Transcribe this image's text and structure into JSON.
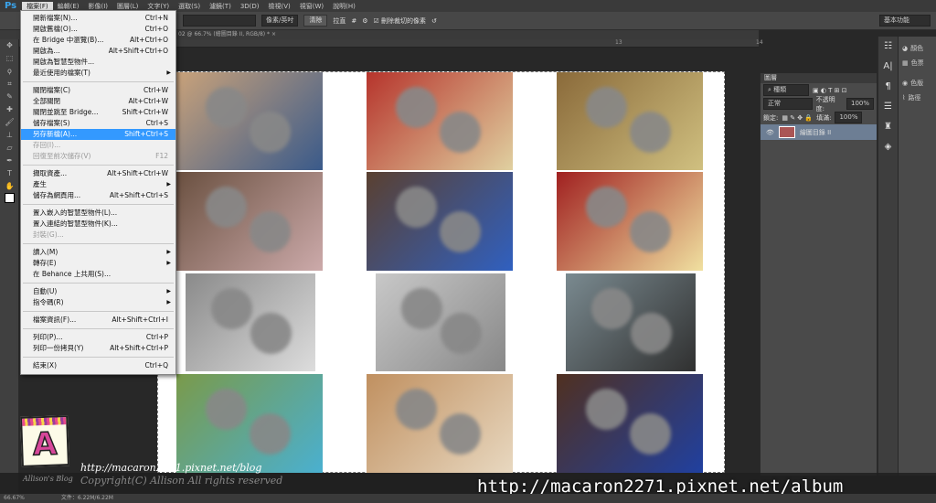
{
  "app": {
    "logo": "Ps"
  },
  "menubar": [
    "檔案(F)",
    "編輯(E)",
    "影像(I)",
    "圖層(L)",
    "文字(Y)",
    "選取(S)",
    "濾鏡(T)",
    "3D(D)",
    "檢視(V)",
    "視窗(W)",
    "說明(H)"
  ],
  "options": {
    "units": "像素/英吋",
    "clear": "清除",
    "straighten": "拉直",
    "delete_cropped": "刪除裁切的像素",
    "delete_cropped_checked": true
  },
  "workspace": "基本功能",
  "doc_tab": "02 @ 66.7% (繪圖目錄 II, RGB/8) *",
  "file_menu": [
    [
      {
        "label": "開新檔案(N)...",
        "shortcut": "Ctrl+N"
      },
      {
        "label": "開啟舊檔(O)...",
        "shortcut": "Ctrl+O"
      },
      {
        "label": "在 Bridge 中瀏覽(B)...",
        "shortcut": "Alt+Ctrl+O"
      },
      {
        "label": "開啟為...",
        "shortcut": "Alt+Shift+Ctrl+O"
      },
      {
        "label": "開啟為智慧型物件...",
        "shortcut": ""
      },
      {
        "label": "最近使用的檔案(T)",
        "shortcut": "",
        "submenu": true
      }
    ],
    [
      {
        "label": "關閉檔案(C)",
        "shortcut": "Ctrl+W"
      },
      {
        "label": "全部關閉",
        "shortcut": "Alt+Ctrl+W"
      },
      {
        "label": "關閉並跳至 Bridge...",
        "shortcut": "Shift+Ctrl+W"
      },
      {
        "label": "儲存檔案(S)",
        "shortcut": "Ctrl+S"
      },
      {
        "label": "另存新檔(A)...",
        "shortcut": "Shift+Ctrl+S",
        "selected": true
      },
      {
        "label": "存回(I)...",
        "shortcut": "",
        "disabled": true
      },
      {
        "label": "回復至前次儲存(V)",
        "shortcut": "F12",
        "disabled": true
      }
    ],
    [
      {
        "label": "擷取資產...",
        "shortcut": "Alt+Shift+Ctrl+W"
      },
      {
        "label": "產生",
        "shortcut": "",
        "submenu": true
      },
      {
        "label": "儲存為網頁用...",
        "shortcut": "Alt+Shift+Ctrl+S"
      }
    ],
    [
      {
        "label": "置入嵌入的智慧型物件(L)...",
        "shortcut": ""
      },
      {
        "label": "置入連結的智慧型物件(K)...",
        "shortcut": ""
      },
      {
        "label": "封裝(G)...",
        "shortcut": "",
        "disabled": true
      }
    ],
    [
      {
        "label": "讀入(M)",
        "shortcut": "",
        "submenu": true
      },
      {
        "label": "轉存(E)",
        "shortcut": "",
        "submenu": true
      },
      {
        "label": "在 Behance 上共用(S)...",
        "shortcut": ""
      }
    ],
    [
      {
        "label": "自動(U)",
        "shortcut": "",
        "submenu": true
      },
      {
        "label": "指令碼(R)",
        "shortcut": "",
        "submenu": true
      }
    ],
    [
      {
        "label": "檔案資訊(F)...",
        "shortcut": "Alt+Shift+Ctrl+I"
      }
    ],
    [
      {
        "label": "列印(P)...",
        "shortcut": "Ctrl+P"
      },
      {
        "label": "列印一份拷貝(Y)",
        "shortcut": "Alt+Shift+Ctrl+P"
      }
    ],
    [
      {
        "label": "結束(X)",
        "shortcut": "Ctrl+Q"
      }
    ]
  ],
  "ruler": {
    "t13": "13",
    "t14": "14"
  },
  "layers": {
    "tab": "圖層",
    "filter": "種類",
    "blend": "正常",
    "opacity_label": "不透明度:",
    "opacity": "100%",
    "lock_label": "鎖定:",
    "fill_label": "填滿:",
    "fill": "100%",
    "layer_name": "繪圖目錄 II"
  },
  "dock": [
    "顏色",
    "色票",
    "色版",
    "路徑"
  ],
  "watermark": {
    "logo_letter": "A",
    "logo_text": "Allison's Blog",
    "blog_url": "http://macaron2271.pixnet.net/blog",
    "copyright": "Copyright(C) Allison All rights reserved",
    "album_url": "http://macaron2271.pixnet.net/album"
  },
  "status": {
    "zoom": "66.67%",
    "doc": "文件：6.22M/6.22M"
  }
}
